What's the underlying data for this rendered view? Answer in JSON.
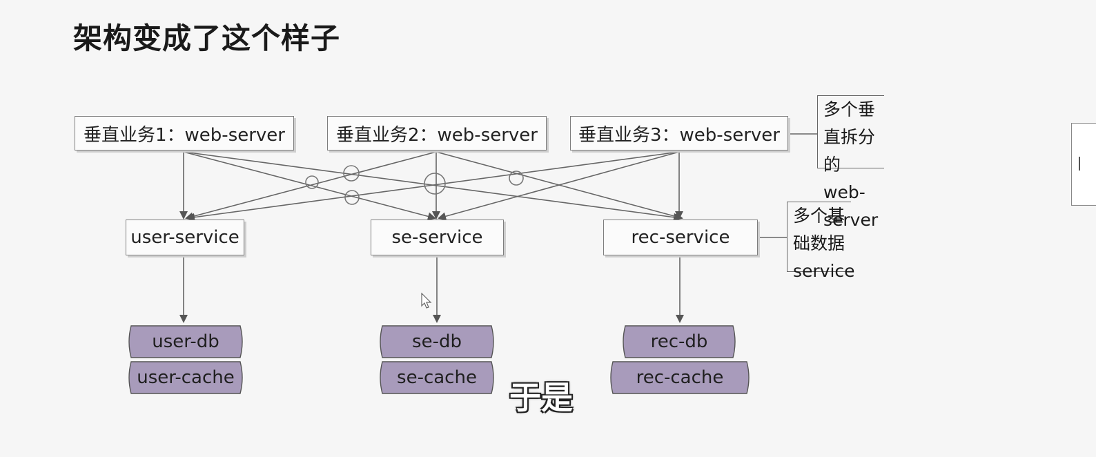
{
  "title": "架构变成了这个样子",
  "web_servers": [
    "垂直业务1：web-server",
    "垂直业务2：web-server",
    "垂直业务3：web-server"
  ],
  "web_note": {
    "line1": "多个垂直拆分的",
    "line2": "web-server"
  },
  "services": [
    "user-service",
    "se-service",
    "rec-service"
  ],
  "service_note": {
    "line1": "多个基础数据",
    "line2": "service"
  },
  "storage": {
    "user": {
      "db": "user-db",
      "cache": "user-cache"
    },
    "se": {
      "db": "se-db",
      "cache": "se-cache"
    },
    "rec": {
      "db": "rec-db",
      "cache": "rec-cache"
    }
  },
  "subtitle": "于是",
  "colors": {
    "db_fill": "#a89bbb",
    "line": "#666666"
  }
}
